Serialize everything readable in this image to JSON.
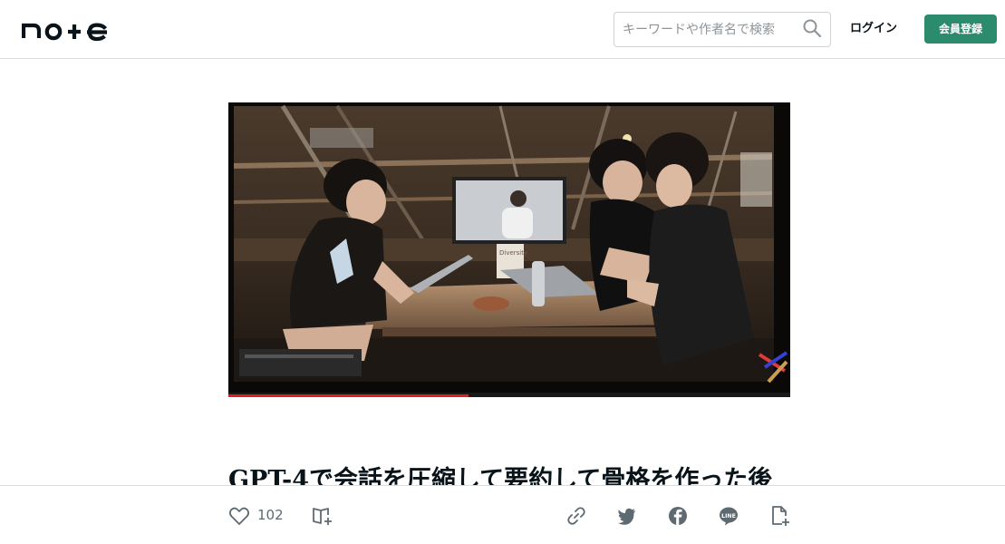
{
  "header": {
    "logo_text": "note",
    "search_placeholder": "キーワードや作者名で検索",
    "login_label": "ログイン",
    "signup_label": "会員登録",
    "accent_color": "#2c8b6c"
  },
  "hero": {
    "screen_sign_text": "Diversity"
  },
  "article": {
    "title": "GPT-4で会話を圧縮して要約して骨格を作った後"
  },
  "actions": {
    "like_count": "102",
    "icons": [
      "heart-icon",
      "magazine-add-icon",
      "link-icon",
      "twitter-icon",
      "facebook-icon",
      "line-icon",
      "note-embed-icon"
    ]
  }
}
